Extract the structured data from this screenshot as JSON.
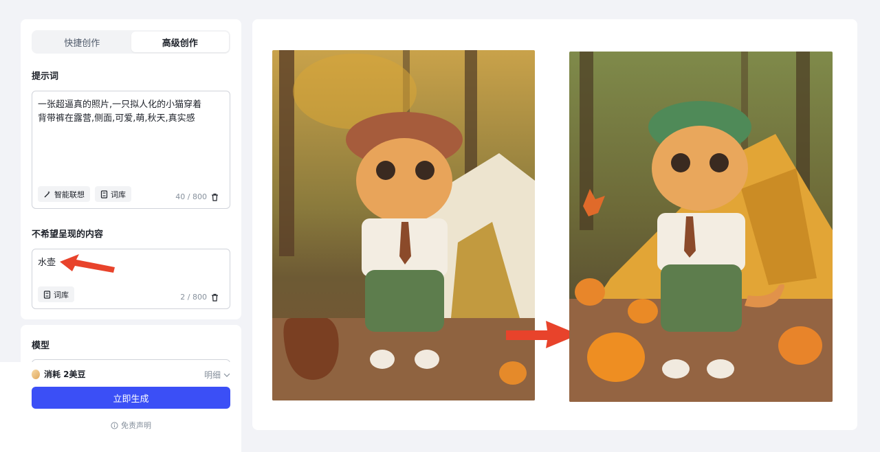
{
  "tabs": [
    {
      "label": "快捷创作",
      "active": false
    },
    {
      "label": "高级创作",
      "active": true
    }
  ],
  "prompt": {
    "title": "提示词",
    "value": "一张超逼真的照片,一只拟人化的小猫穿着背带裤在露营,侧面,可爱,萌,秋天,真实感",
    "smart_btn": "智能联想",
    "lib_btn": "词库",
    "count": "40 / 800"
  },
  "negative": {
    "title": "不希望呈现的内容",
    "value": "水壶",
    "lib_btn": "词库",
    "count": "2 / 800"
  },
  "model": {
    "title": "模型"
  },
  "footer": {
    "cost_label": "消耗 2美豆",
    "detail_label": "明细",
    "generate_label": "立即生成",
    "disclaimer_label": "免责声明"
  },
  "colors": {
    "accent": "#3b4ff6",
    "arrow": "#e8432b"
  },
  "icons": [
    "wand-icon",
    "book-icon",
    "trash-icon",
    "chevron-down-icon",
    "info-icon",
    "bean-icon",
    "arrow-icon"
  ]
}
